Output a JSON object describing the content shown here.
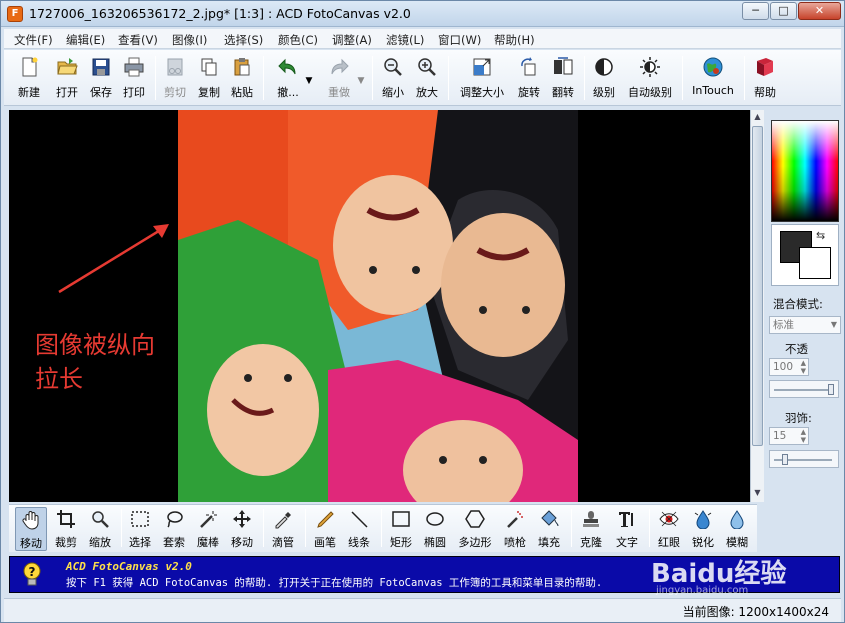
{
  "window": {
    "title": "1727006_163206536172_2.jpg* [1:3] : ACD FotoCanvas v2.0",
    "app_icon_glyph": "F"
  },
  "window_controls": {
    "min": "─",
    "max": "□",
    "close": "✕"
  },
  "menu": [
    "文件(F)",
    "编辑(E)",
    "查看(V)",
    "图像(I)",
    "选择(S)",
    "颜色(C)",
    "调整(A)",
    "滤镜(L)",
    "窗口(W)",
    "帮助(H)"
  ],
  "toolbar": {
    "new": "新建",
    "open": "打开",
    "save": "保存",
    "print": "打印",
    "cut": "剪切",
    "copy": "复制",
    "paste": "粘贴",
    "undo": "撤...",
    "redo": "重做",
    "zoom_out": "缩小",
    "zoom_in": "放大",
    "resize": "调整大小",
    "rotate": "旋转",
    "flip": "翻转",
    "levels": "级别",
    "auto_levels": "自动级别",
    "intouch": "InTouch",
    "help": "帮助"
  },
  "annotation": {
    "line1": "图像被纵向",
    "line2": "拉长"
  },
  "panel": {
    "blend_label": "混合模式:",
    "blend_value": "标准",
    "opacity_label": "不透",
    "opacity_value": "100",
    "feather_label": "羽饰:",
    "feather_value": "15"
  },
  "tools": {
    "move": "移动",
    "crop": "裁剪",
    "zoom": "缩放",
    "select": "选择",
    "lasso": "套索",
    "wand": "魔棒",
    "move2": "移动",
    "eyedropper": "滴管",
    "pen": "画笔",
    "line": "线条",
    "rect": "矩形",
    "ellipse": "椭圆",
    "polygon": "多边形",
    "spray": "喷枪",
    "fill": "填充",
    "clone": "克隆",
    "text": "文字",
    "redeye": "红眼",
    "sharpen": "锐化",
    "blur": "模糊"
  },
  "help": {
    "title": "ACD FotoCanvas v2.0",
    "text": "按下 F1 获得 ACD FotoCanvas 的帮助. 打开关于正在使用的 FotoCanvas 工作簿的工具和菜单目录的帮助."
  },
  "status": {
    "current_image": "当前图像: 1200x1400x24"
  },
  "watermark": {
    "brand": "Baidu经验",
    "url": "jingyan.baidu.com"
  },
  "colors": {
    "annotation": "#e63a32",
    "help_bg": "#0a0aa8",
    "help_title": "#ffe14a"
  }
}
